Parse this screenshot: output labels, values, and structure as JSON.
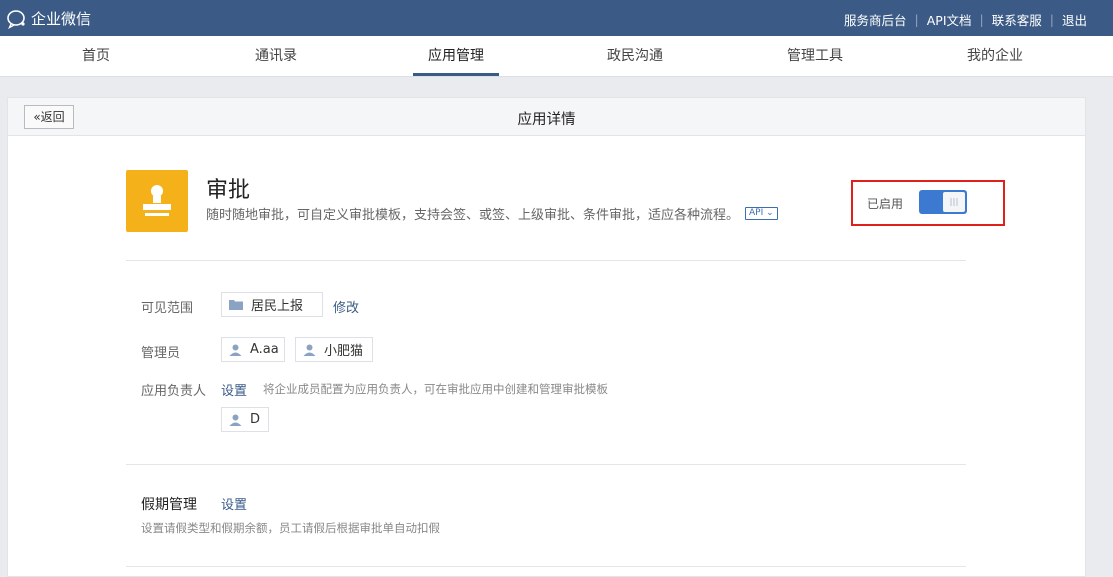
{
  "topbar": {
    "logo_text": "企业微信",
    "links": [
      "服务商后台",
      "API文档",
      "联系客服",
      "退出"
    ]
  },
  "nav": {
    "items": [
      "首页",
      "通讯录",
      "应用管理",
      "政民沟通",
      "管理工具",
      "我的企业"
    ],
    "active_index": 2
  },
  "card": {
    "back_label": "返回",
    "title": "应用详情"
  },
  "app": {
    "name": "审批",
    "description": "随时随地审批，可自定义审批模板，支持会签、或签、上级审批、条件审批，适应各种流程。",
    "api_tag": "API",
    "status_label": "已启用",
    "enabled": true,
    "icon": "stamp-icon",
    "icon_color": "#f5b119"
  },
  "settings": {
    "visible_scope": {
      "label": "可见范围",
      "value": "居民上报",
      "edit_label": "修改"
    },
    "admins": {
      "label": "管理员",
      "members": [
        "A.aa",
        "小肥猫"
      ]
    },
    "owner": {
      "label": "应用负责人",
      "set_label": "设置",
      "hint": "将企业成员配置为应用负责人，可在审批应用中创建和管理审批模板",
      "members": [
        "D"
      ]
    }
  },
  "leave": {
    "title": "假期管理",
    "set_label": "设置",
    "hint": "设置请假类型和假期余额，员工请假后根据审批单自动扣假"
  },
  "colors": {
    "topbar": "#3b5b86",
    "accent": "#3b7ad0",
    "highlight_border": "#e0201b"
  }
}
